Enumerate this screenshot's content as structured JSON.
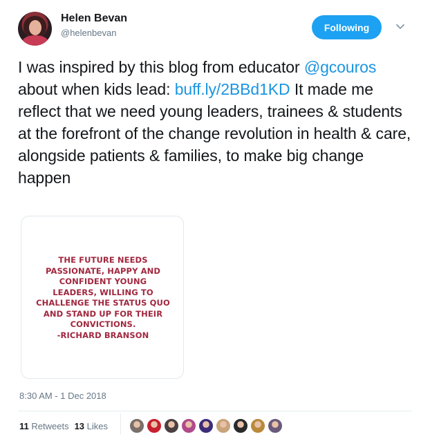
{
  "author": {
    "display_name": "Helen Bevan",
    "screen_name": "@helenbevan",
    "avatar_icon": "profile-photo"
  },
  "follow_button": {
    "label": "Following",
    "color": "#1da1f2"
  },
  "caret_icon": "chevron-down-icon",
  "tweet": {
    "text_part1": "I was inspired by this blog from educator ",
    "mention": "@gcouros",
    "text_part2": " about when kids lead: ",
    "link": "buff.ly/2BBd1KD",
    "text_part3": " It made me reflect that we need young leaders, trainees & students at the forefront of the change revolution in health & care, alongside patients & families, to make big change happen",
    "link_color": "#1b95e0"
  },
  "media": {
    "quote_lines": [
      "THE FUTURE NEEDS",
      "PASSIONATE, HAPPY AND",
      "CONFIDENT YOUNG",
      "LEADERS, WILLING TO",
      "CHALLENGE THE STATUS QUO",
      "AND STAND UP FOR THEIR",
      "CONVICTIONS.",
      "-RICHARD BRANSON"
    ],
    "quote_color": "#a1283f"
  },
  "timestamp": "8:30 AM - 1 Dec 2018",
  "stats": {
    "retweets_count": "11",
    "retweets_label": "Retweets",
    "likes_count": "13",
    "likes_label": "Likes"
  },
  "likers": [
    {
      "icon": "user-avatar",
      "color": "#7a6f6a"
    },
    {
      "icon": "user-avatar",
      "color": "#c8202f"
    },
    {
      "icon": "user-avatar",
      "color": "#4a4042"
    },
    {
      "icon": "user-avatar",
      "color": "#b04a8a"
    },
    {
      "icon": "user-avatar",
      "color": "#3b2d7a"
    },
    {
      "icon": "user-avatar",
      "color": "#c9a37a"
    },
    {
      "icon": "user-avatar",
      "color": "#2a2a2a"
    },
    {
      "icon": "user-avatar",
      "color": "#b98a3c"
    },
    {
      "icon": "user-avatar",
      "color": "#6a5a7a"
    }
  ]
}
